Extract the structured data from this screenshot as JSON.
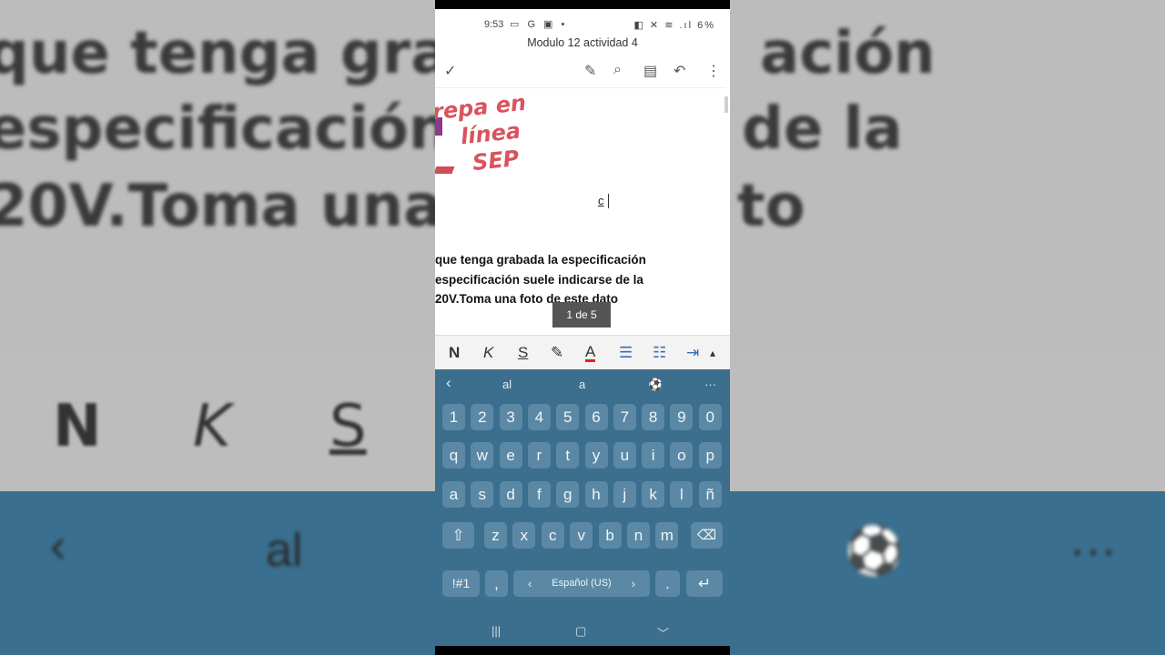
{
  "status": {
    "time": "9:53",
    "left_icons": "▭ G ▣ •",
    "right_icons": "◧ ✕ ≋ .ıl",
    "battery": "6%"
  },
  "document": {
    "title": "Modulo 12 actividad 4"
  },
  "toolbar": {
    "check": "✓",
    "pen": "✎",
    "search": "⌕",
    "reader": "▤",
    "undo": "↶",
    "more": "⋮"
  },
  "page": {
    "logo_lines": [
      "repa en",
      "línea",
      "SEP"
    ],
    "typed_char": "c",
    "text_lines": [
      "que tenga grabada la especificación",
      "especificación suele indicarse de la",
      "20V.Toma una foto de este dato"
    ],
    "page_indicator": "1 de 5"
  },
  "format_bar": {
    "bold": "N",
    "italic": "K",
    "underline": "S",
    "highlight": "✎",
    "font_color": "A",
    "bullets": "☰",
    "numbering": "☷",
    "indent": "⇥",
    "expand": "▴",
    "font_color_value": "#e02020"
  },
  "background": {
    "lines": [
      "que tenga grabada",
      "especificación suel",
      "20V.Toma una foto"
    ],
    "right_fragments": [
      "ación",
      "de la",
      "to"
    ],
    "tools": [
      "N",
      "K",
      "S"
    ],
    "suggestion": "al"
  },
  "keyboard": {
    "suggestions": [
      "al",
      "a"
    ],
    "back": "‹",
    "emoji": "⚽",
    "more": "···",
    "numbers": [
      "1",
      "2",
      "3",
      "4",
      "5",
      "6",
      "7",
      "8",
      "9",
      "0"
    ],
    "row1": [
      "q",
      "w",
      "e",
      "r",
      "t",
      "y",
      "u",
      "i",
      "o",
      "p"
    ],
    "row2": [
      "a",
      "s",
      "d",
      "f",
      "g",
      "h",
      "j",
      "k",
      "l",
      "ñ"
    ],
    "row3": [
      "z",
      "x",
      "c",
      "v",
      "b",
      "n",
      "m"
    ],
    "shift": "⇧",
    "backspace": "⌫",
    "symbols": "!#1",
    "comma": ",",
    "space_label": "Español (US)",
    "space_left": "‹",
    "space_right": "›",
    "period": ".",
    "enter": "↵",
    "nav": [
      "|||",
      "▢",
      "﹀"
    ]
  }
}
